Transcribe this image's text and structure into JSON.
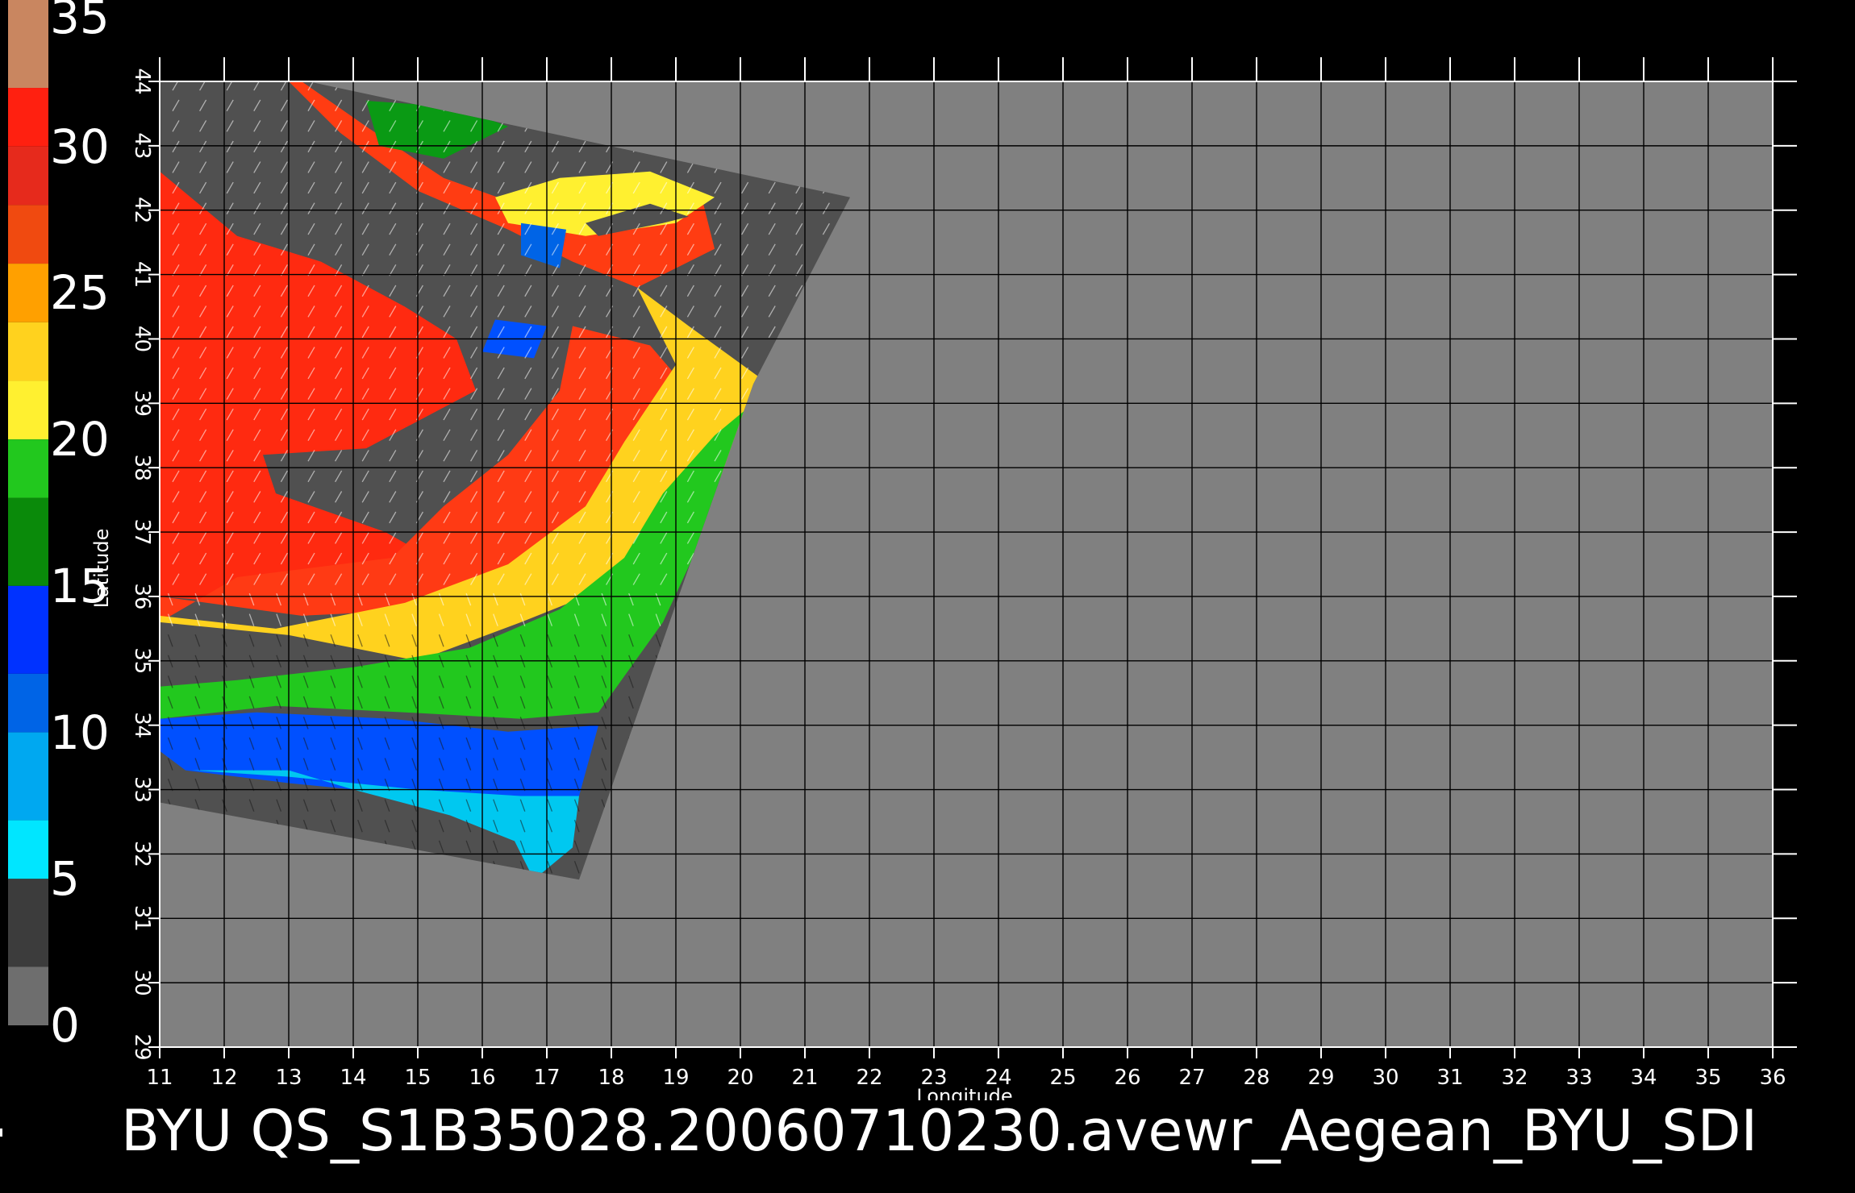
{
  "caption": "BYU  QS_S1B35028.20060710230.avewr_Aegean_BYU_SDI",
  "colorbar": {
    "labels": [
      "35",
      "30",
      "25",
      "20",
      "15",
      "10",
      "5",
      "0"
    ],
    "segments": [
      {
        "from": 32,
        "to": 35,
        "color": "#c98660"
      },
      {
        "from": 30,
        "to": 32,
        "color": "#ff2010"
      },
      {
        "from": 28,
        "to": 30,
        "color": "#e62a1c"
      },
      {
        "from": 26,
        "to": 28,
        "color": "#f04a10"
      },
      {
        "from": 24,
        "to": 26,
        "color": "#ffa000"
      },
      {
        "from": 22,
        "to": 24,
        "color": "#ffd21e"
      },
      {
        "from": 20,
        "to": 22,
        "color": "#fff030"
      },
      {
        "from": 18,
        "to": 20,
        "color": "#22c81e"
      },
      {
        "from": 15,
        "to": 18,
        "color": "#0a8a0a"
      },
      {
        "from": 12,
        "to": 15,
        "color": "#0032ff"
      },
      {
        "from": 10,
        "to": 12,
        "color": "#0064e6"
      },
      {
        "from": 7,
        "to": 10,
        "color": "#00a8f0"
      },
      {
        "from": 5,
        "to": 7,
        "color": "#00e6ff"
      },
      {
        "from": 2,
        "to": 5,
        "color": "#3c3c3c"
      },
      {
        "from": 0,
        "to": 2,
        "color": "#6e6e6e"
      }
    ]
  },
  "map": {
    "xlabel": "Longitude",
    "ylabel": "Latitude",
    "lon_range": [
      11,
      36
    ],
    "lat_range": [
      29,
      44
    ],
    "lon_ticks": [
      "11",
      "12",
      "13",
      "14",
      "15",
      "16",
      "17",
      "18",
      "19",
      "20",
      "21",
      "22",
      "23",
      "24",
      "25",
      "26",
      "27",
      "28",
      "29",
      "30",
      "31",
      "32",
      "33",
      "34",
      "35",
      "36"
    ],
    "lat_ticks": [
      "29",
      "30",
      "31",
      "32",
      "33",
      "34",
      "35",
      "36",
      "37",
      "38",
      "39",
      "40",
      "41",
      "42",
      "43",
      "44"
    ],
    "grid": true,
    "background_color": "#808080",
    "swath_color": "#505050",
    "swath_polygon_lonlat": [
      [
        13.3,
        44.0
      ],
      [
        21.7,
        42.2
      ],
      [
        20.2,
        39.3
      ],
      [
        17.5,
        31.6
      ],
      [
        11.0,
        32.8
      ],
      [
        11.0,
        44.0
      ]
    ],
    "wind_regions": [
      {
        "level": "strong",
        "color": "#ff2a10",
        "lonlat": [
          [
            11.0,
            42.6
          ],
          [
            12.2,
            41.6
          ],
          [
            13.5,
            41.2
          ],
          [
            14.8,
            40.5
          ],
          [
            15.6,
            40.0
          ],
          [
            15.9,
            39.2
          ],
          [
            14.2,
            38.3
          ],
          [
            12.6,
            38.2
          ],
          [
            12.8,
            37.6
          ],
          [
            14.5,
            37.0
          ],
          [
            15.2,
            36.6
          ],
          [
            14.7,
            36.1
          ],
          [
            13.4,
            35.8
          ],
          [
            11.0,
            36.0
          ]
        ]
      },
      {
        "level": "strong",
        "color": "#ff3a14",
        "lonlat": [
          [
            11.0,
            36.0
          ],
          [
            13.2,
            35.7
          ],
          [
            15.2,
            35.8
          ],
          [
            16.6,
            36.6
          ],
          [
            17.8,
            37.5
          ],
          [
            18.2,
            38.4
          ],
          [
            19.2,
            39.2
          ],
          [
            18.6,
            39.9
          ],
          [
            17.4,
            40.2
          ],
          [
            17.2,
            39.2
          ],
          [
            16.4,
            38.2
          ],
          [
            15.4,
            37.4
          ],
          [
            14.6,
            36.6
          ],
          [
            12.2,
            36.3
          ],
          [
            11.0,
            35.6
          ]
        ]
      },
      {
        "level": "strong",
        "color": "#ff3c12",
        "lonlat": [
          [
            13.2,
            44.0
          ],
          [
            14.2,
            43.3
          ],
          [
            15.4,
            42.5
          ],
          [
            16.8,
            42.0
          ],
          [
            18.0,
            42.2
          ],
          [
            19.4,
            42.2
          ],
          [
            19.6,
            41.4
          ],
          [
            18.4,
            40.8
          ],
          [
            17.4,
            41.2
          ],
          [
            16.4,
            41.7
          ],
          [
            15.0,
            42.3
          ],
          [
            13.8,
            43.2
          ],
          [
            13.0,
            44.0
          ]
        ]
      },
      {
        "level": "moderate",
        "color": "#ffd21e",
        "lonlat": [
          [
            11.0,
            35.6
          ],
          [
            13.0,
            35.4
          ],
          [
            15.0,
            35.0
          ],
          [
            16.6,
            35.6
          ],
          [
            17.6,
            36.0
          ],
          [
            18.6,
            36.2
          ],
          [
            19.2,
            37.0
          ],
          [
            20.0,
            38.4
          ],
          [
            20.3,
            39.4
          ],
          [
            19.2,
            40.2
          ],
          [
            18.4,
            40.8
          ],
          [
            19.0,
            39.6
          ],
          [
            18.2,
            38.4
          ],
          [
            17.6,
            37.4
          ],
          [
            16.4,
            36.5
          ],
          [
            14.8,
            35.9
          ],
          [
            12.8,
            35.5
          ],
          [
            11.0,
            35.7
          ]
        ]
      },
      {
        "level": "moderate",
        "color": "#fff030",
        "lonlat": [
          [
            16.4,
            41.8
          ],
          [
            17.6,
            41.6
          ],
          [
            19.0,
            41.8
          ],
          [
            19.6,
            42.2
          ],
          [
            18.6,
            42.6
          ],
          [
            17.2,
            42.5
          ],
          [
            16.2,
            42.2
          ]
        ]
      },
      {
        "level": "fresh",
        "color": "#22c81e",
        "lonlat": [
          [
            11.0,
            34.1
          ],
          [
            12.8,
            34.3
          ],
          [
            14.8,
            34.2
          ],
          [
            16.6,
            34.1
          ],
          [
            17.8,
            34.2
          ],
          [
            18.8,
            35.6
          ],
          [
            19.4,
            36.9
          ],
          [
            20.0,
            38.0
          ],
          [
            20.2,
            39.0
          ],
          [
            19.6,
            38.5
          ],
          [
            18.8,
            37.6
          ],
          [
            18.2,
            36.6
          ],
          [
            17.2,
            35.8
          ],
          [
            15.8,
            35.2
          ],
          [
            14.0,
            34.9
          ],
          [
            12.2,
            34.7
          ],
          [
            11.0,
            34.6
          ]
        ]
      },
      {
        "level": "fresh",
        "color": "#0a9a14",
        "lonlat": [
          [
            14.2,
            43.7
          ],
          [
            15.6,
            43.6
          ],
          [
            16.4,
            43.3
          ],
          [
            15.4,
            42.8
          ],
          [
            14.4,
            43.0
          ]
        ]
      },
      {
        "level": "light",
        "color": "#0050ff",
        "lonlat": [
          [
            11.0,
            34.1
          ],
          [
            12.5,
            34.2
          ],
          [
            14.6,
            34.1
          ],
          [
            16.4,
            33.9
          ],
          [
            17.8,
            34.0
          ],
          [
            17.5,
            32.9
          ],
          [
            16.6,
            32.8
          ],
          [
            15.0,
            32.9
          ],
          [
            13.0,
            33.1
          ],
          [
            11.4,
            33.3
          ],
          [
            11.0,
            33.6
          ]
        ]
      },
      {
        "level": "calm",
        "color": "#00c8f0",
        "lonlat": [
          [
            11.5,
            33.3
          ],
          [
            13.0,
            33.3
          ],
          [
            14.0,
            33.0
          ],
          [
            15.5,
            32.6
          ],
          [
            16.5,
            32.2
          ],
          [
            16.8,
            31.6
          ],
          [
            17.4,
            32.1
          ],
          [
            17.5,
            32.9
          ],
          [
            16.6,
            32.9
          ],
          [
            15.0,
            33.0
          ],
          [
            13.0,
            33.2
          ]
        ]
      },
      {
        "level": "light",
        "color": "#0064e6",
        "lonlat": [
          [
            16.6,
            41.3
          ],
          [
            17.2,
            41.1
          ],
          [
            17.3,
            41.7
          ],
          [
            16.6,
            41.8
          ]
        ]
      },
      {
        "level": "light",
        "color": "#0050ff",
        "lonlat": [
          [
            16.0,
            39.8
          ],
          [
            16.8,
            39.7
          ],
          [
            17.0,
            40.2
          ],
          [
            16.2,
            40.3
          ]
        ]
      },
      {
        "level": "land",
        "color": "#505050",
        "lonlat": [
          [
            17.8,
            41.6
          ],
          [
            18.8,
            41.8
          ],
          [
            19.2,
            41.9
          ],
          [
            18.6,
            42.1
          ],
          [
            17.6,
            41.8
          ]
        ]
      }
    ]
  }
}
